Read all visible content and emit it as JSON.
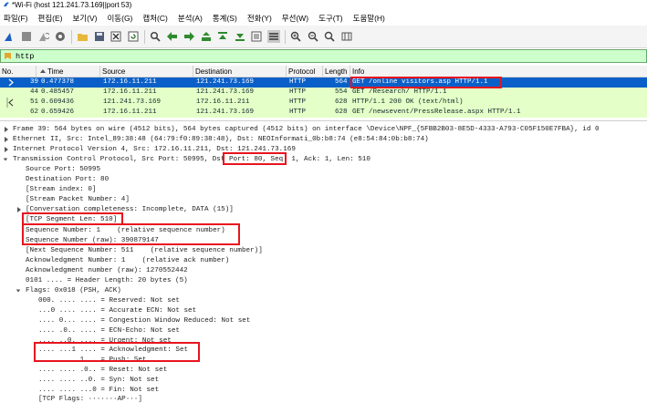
{
  "window": {
    "title": "*Wi-Fi (host 121.241.73.169||port 53)"
  },
  "menu": [
    "파일(F)",
    "편집(E)",
    "보기(V)",
    "이동(G)",
    "캡처(C)",
    "분석(A)",
    "통계(S)",
    "전화(Y)",
    "무선(W)",
    "도구(T)",
    "도움말(H)"
  ],
  "toolbar": {
    "icons": [
      "shark-fin-start-icon",
      "stop-capture-icon",
      "restart-capture-icon",
      "capture-options-icon",
      "open-file-icon",
      "save-file-icon",
      "close-file-icon",
      "reload-file-icon",
      "find-packet-icon",
      "go-back-icon",
      "go-forward-icon",
      "go-to-packet-icon",
      "go-first-icon",
      "go-last-icon",
      "autoscroll-icon",
      "colorize-icon",
      "zoom-in-icon",
      "zoom-out-icon",
      "zoom-reset-icon",
      "resize-columns-icon"
    ]
  },
  "filter": {
    "text": "http"
  },
  "packet_list": {
    "columns": [
      "No.",
      "Time",
      "Source",
      "Destination",
      "Protocol",
      "Length",
      "Info"
    ],
    "rows": [
      {
        "no": "39",
        "time": "0.477378",
        "source": "172.16.11.211",
        "destination": "121.241.73.169",
        "protocol": "HTTP",
        "length": "564",
        "info": "GET /online visitors.asp HTTP/1.1",
        "selected": true
      },
      {
        "no": "44",
        "time": "0.485457",
        "source": "172.16.11.211",
        "destination": "121.241.73.169",
        "protocol": "HTTP",
        "length": "554",
        "info": "GET /Research/ HTTP/1.1",
        "selected": false
      },
      {
        "no": "51",
        "time": "0.609436",
        "source": "121.241.73.169",
        "destination": "172.16.11.211",
        "protocol": "HTTP",
        "length": "628",
        "info": "HTTP/1.1 200 OK  (text/html)",
        "selected": false
      },
      {
        "no": "62",
        "time": "0.659426",
        "source": "172.16.11.211",
        "destination": "121.241.73.169",
        "protocol": "HTTP",
        "length": "628",
        "info": "GET /newsevent/PressRelease.aspx HTTP/1.1",
        "selected": false
      }
    ]
  },
  "details": {
    "frame": "Frame 39: 564 bytes on wire (4512 bits), 564 bytes captured (4512 bits) on interface \\Device\\NPF_{5FBB2B03-8E5D-4333-A793-C05F150E7FBA}, id 0",
    "ethernet": "Ethernet II, Src: Intel_89:38:48 (64:79:f0:89:38:48), Dst: NEOInformati_0b:b8:74 (e8:54:84:0b:b8:74)",
    "ip": "Internet Protocol Version 4, Src: 172.16.11.211, Dst: 121.241.73.169",
    "tcp_prefix": "Transmission Control Protocol, Src Port: 50995, ",
    "tcp_dst": "Dst Port: 80",
    "tcp_suffix": ", Seq: 1, Ack: 1, Len: 510",
    "src_port": "Source Port: 50995",
    "dst_port": "Destination Port: 80",
    "stream_index": "[Stream index: 0]",
    "stream_packet": "[Stream Packet Number: 4]",
    "conversation": "[Conversation completeness: Incomplete, DATA (15)]",
    "segment_len": "[TCP Segment Len: 510]",
    "seq": "Sequence Number: 1    (relative sequence number)",
    "seq_raw": "Sequence Number (raw): 390879147",
    "next_seq": "[Next Sequence Number: 511    (relative sequence number)]",
    "ack": "Acknowledgment Number: 1    (relative ack number)",
    "ack_raw": "Acknowledgment number (raw): 1270552442",
    "header_len": "0101 .... = Header Length: 20 bytes (5)",
    "flags": "Flags: 0x018 (PSH, ACK)",
    "flag_lines": [
      "000. .... .... = Reserved: Not set",
      "...0 .... .... = Accurate ECN: Not set",
      ".... 0... .... = Congestion Window Reduced: Not set",
      ".... .0.. .... = ECN-Echo: Not set",
      ".... ..0. .... = Urgent: Not set",
      ".... ...1 .... = Acknowledgment: Set",
      ".... .... 1... = Push: Set",
      ".... .... .0.. = Reset: Not set",
      ".... .... ..0. = Syn: Not set",
      ".... .... ...0 = Fin: Not set",
      "[TCP Flags: ·······AP···]"
    ]
  },
  "colors": {
    "selected_row": "#0a60c8",
    "http_row": "#e4ffc7",
    "filter_bg": "#ccffcc",
    "highlight_box": "#e8141e"
  }
}
